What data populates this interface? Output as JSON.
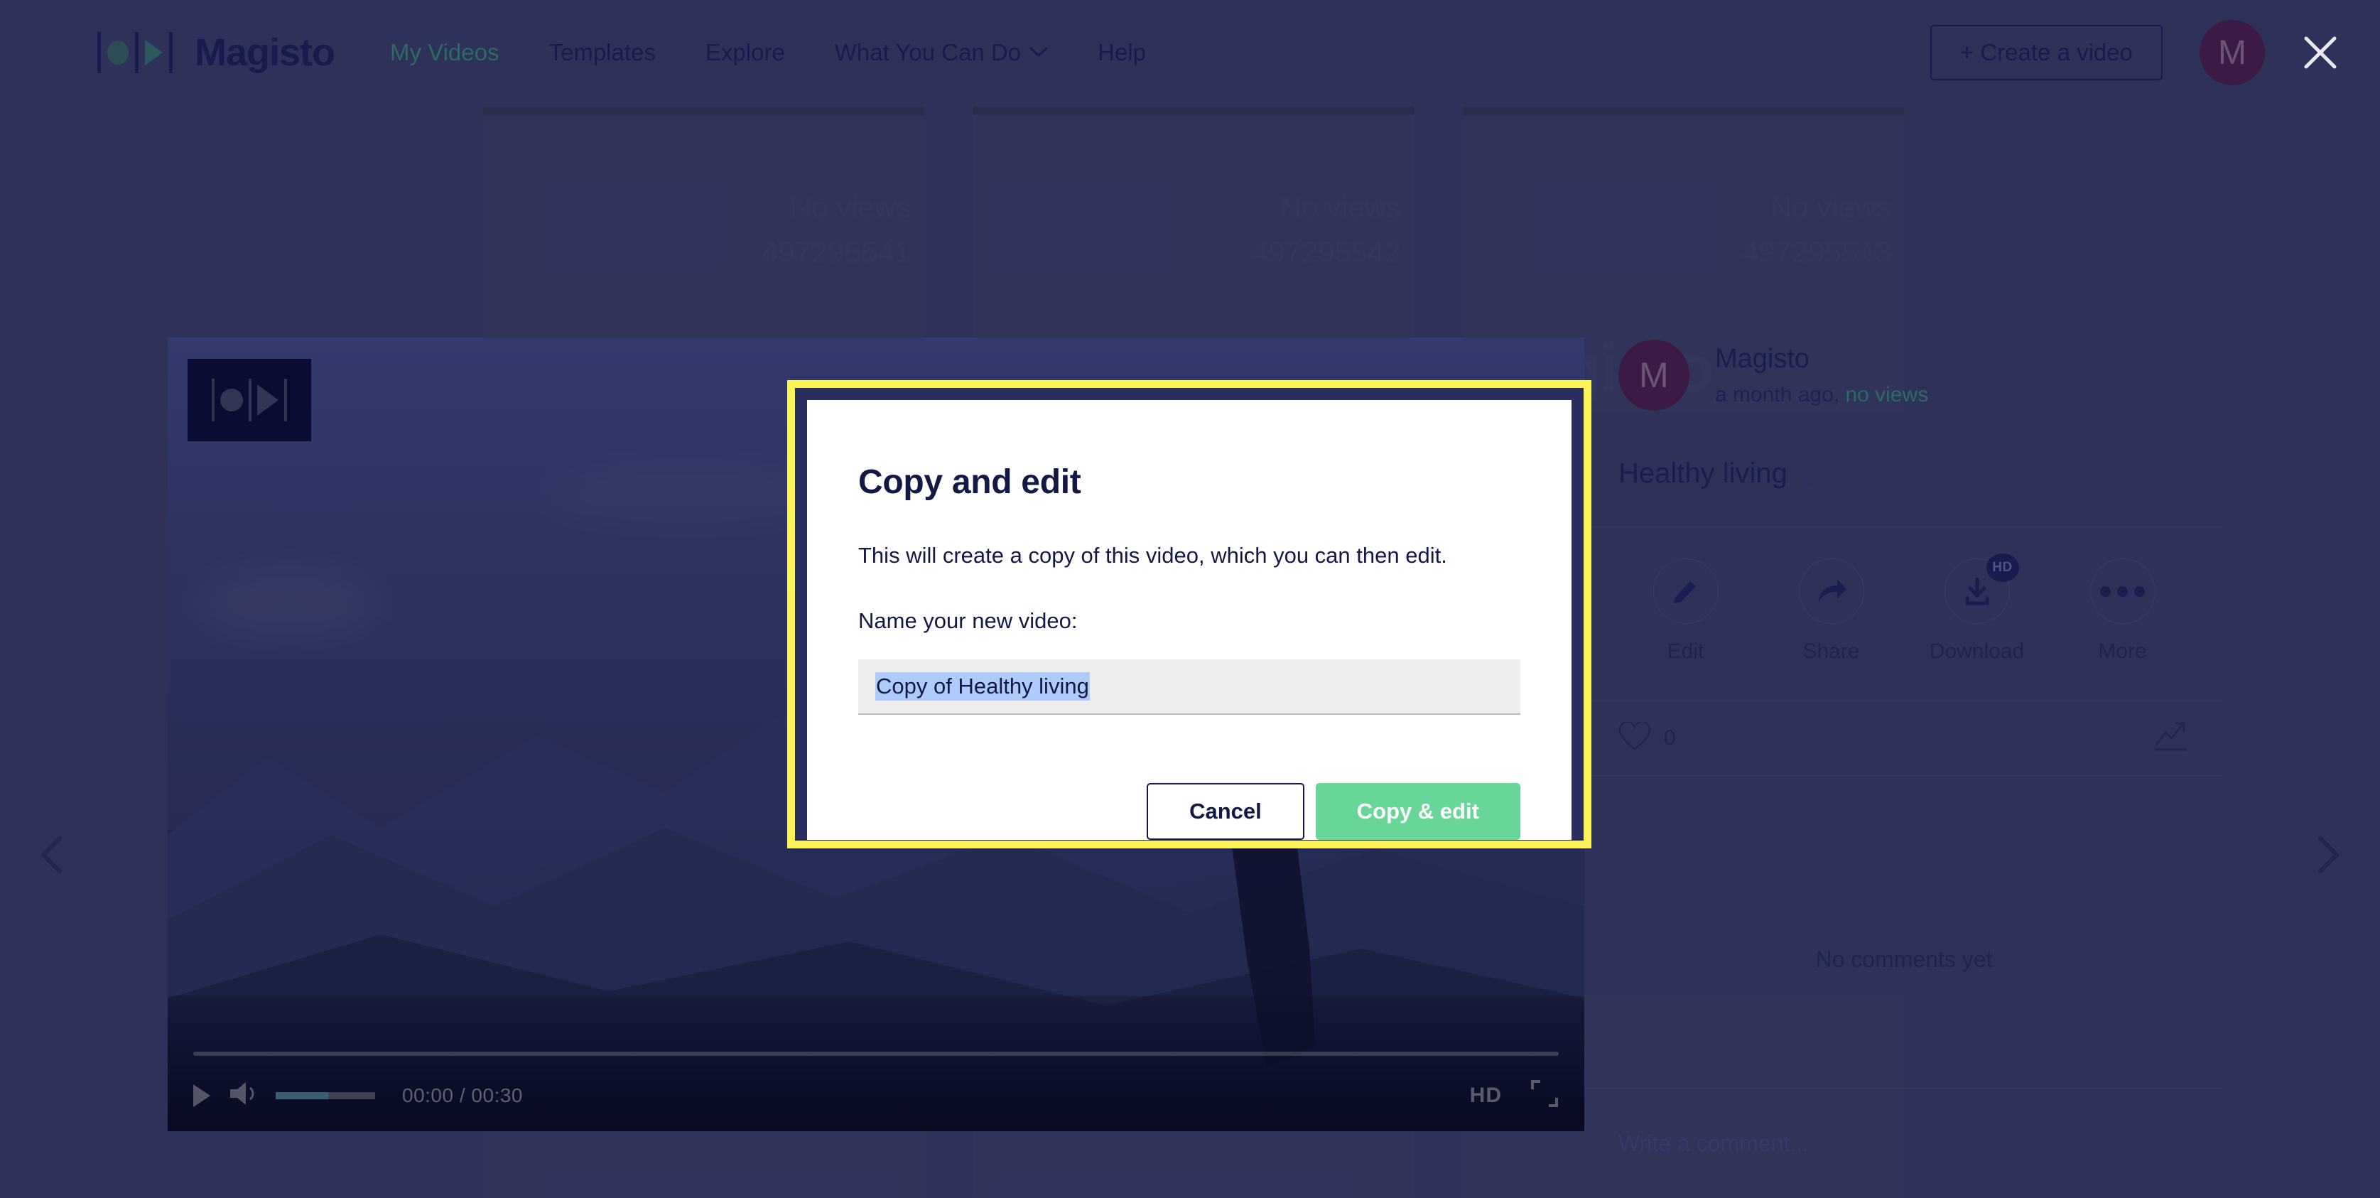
{
  "header": {
    "logo_text": "Magisto",
    "logo_icon": "magisto-logo-icon",
    "nav": [
      {
        "label": "My Videos",
        "muted": true
      },
      {
        "label": "Templates",
        "muted": false
      },
      {
        "label": "Explore",
        "muted": false
      },
      {
        "label": "What You Can Do",
        "muted": false,
        "has_caret": true
      },
      {
        "label": "Help",
        "muted": false
      }
    ],
    "create_button": "+ Create a video",
    "avatar_initial": "M",
    "close_icon": "close-icon"
  },
  "player": {
    "watermark_icon": "magisto-watermark-icon",
    "play_icon": "play-icon",
    "speaker_icon": "speaker-icon",
    "current_time": "00:00",
    "time_separator": "/",
    "total_time": "00:30",
    "quality_label": "HD",
    "fullscreen_icon": "fullscreen-icon",
    "progress_percent": 0,
    "volume_percent": 53
  },
  "nav_arrows": {
    "prev_icon": "chevron-left-icon",
    "next_icon": "chevron-right-icon"
  },
  "sidebar": {
    "avatar_initial": "M",
    "author": "Magisto",
    "posted": "a month ago,",
    "views": "no views",
    "video_title": "Healthy living",
    "edit_title_icon": "pencil-icon",
    "actions": [
      {
        "label": "Edit",
        "icon": "pencil-icon",
        "badge": ""
      },
      {
        "label": "Share",
        "icon": "share-arrow-icon",
        "badge": ""
      },
      {
        "label": "Download",
        "icon": "download-icon",
        "badge": "HD"
      },
      {
        "label": "More",
        "icon": "ellipsis-icon",
        "badge": ""
      }
    ],
    "like_icon": "heart-icon",
    "like_count": "0",
    "stats_icon": "trending-up-icon",
    "no_comments": "No comments yet",
    "comment_placeholder": "Write a comment..."
  },
  "modal": {
    "title": "Copy and edit",
    "description": "This will create a copy of this video, which you can then edit.",
    "field_label": "Name your new video:",
    "input_value": "Copy of Healthy living",
    "input_placeholder": "Name your new video",
    "cancel_label": "Cancel",
    "confirm_label": "Copy & edit",
    "highlight_color": "#fdf359",
    "primary_color": "#67d698"
  },
  "background_cards": [
    {
      "ghost_line1": "No views",
      "ghost_line2": "497295541"
    },
    {
      "ghost_line1": "No views",
      "ghost_line2": "497295542"
    },
    {
      "ghost_line1": "No views",
      "ghost_line2": "497295543"
    }
  ]
}
